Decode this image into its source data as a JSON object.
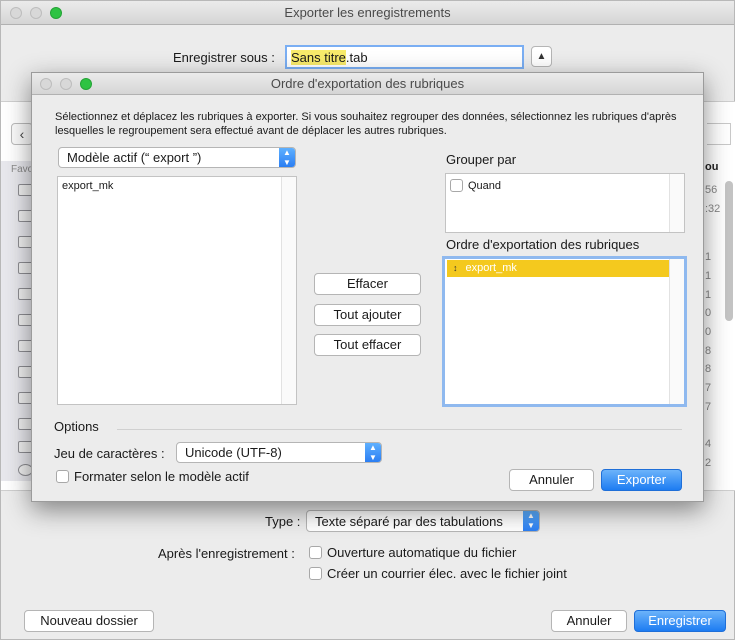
{
  "outer": {
    "title": "Exporter les enregistrements",
    "save_as_label": "Enregistrer sous :",
    "filename_highlight": "Sans titre",
    "filename_ext": ".tab",
    "disclosure_icon": "chevron-up",
    "favorites_label": "Favo",
    "right_column_header": "ou",
    "right_column_values": [
      "56",
      ":32",
      "1",
      "1",
      "1",
      "0",
      "0",
      "8",
      "8",
      "7",
      "7",
      "4",
      "2"
    ],
    "type_label": "Type :",
    "type_value": "Texte séparé par des tabulations",
    "after_save_label": "Après l'enregistrement :",
    "auto_open_label": "Ouverture automatique du fichier",
    "email_label": "Créer un courrier élec. avec le fichier joint",
    "new_folder_button": "Nouveau dossier",
    "cancel_button": "Annuler",
    "save_button": "Enregistrer"
  },
  "inner": {
    "title": "Ordre d'exportation des rubriques",
    "instructions": "Sélectionnez et déplacez les rubriques à exporter.  Si vous souhaitez regrouper des données, sélectionnez les rubriques d'après lesquelles le regroupement sera effectué avant de déplacer les autres rubriques.",
    "model_select": "Modèle actif (“  export ”)",
    "source_fields": [
      "export_mk"
    ],
    "clear_button": "Effacer",
    "add_all_button": "Tout ajouter",
    "clear_all_button": "Tout effacer",
    "group_by_label": "Grouper par",
    "group_by_options": [
      "Quand"
    ],
    "export_order_label": "Ordre d'exportation des rubriques",
    "export_order_fields": [
      "export_mk"
    ],
    "options_label": "Options",
    "charset_label": "Jeu de caractères :",
    "charset_value": "Unicode (UTF-8)",
    "format_label": "Formater selon le modèle actif",
    "cancel_button": "Annuler",
    "export_button": "Exporter"
  },
  "colors": {
    "accent_blue": "#1d7cf2",
    "highlight_yellow": "#f8eb6b",
    "selected_row": "#f4c91e",
    "traffic_green": "#2ec343"
  }
}
